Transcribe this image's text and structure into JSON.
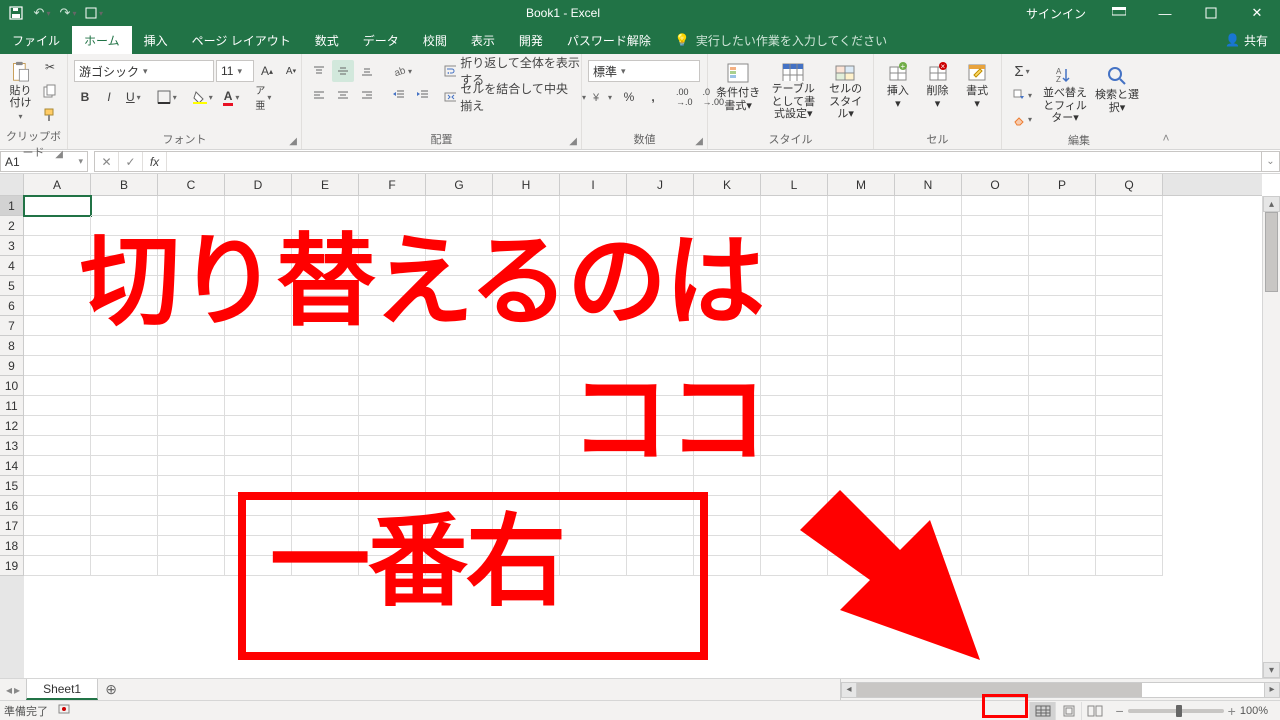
{
  "title": "Book1  -  Excel",
  "signin": "サインイン",
  "tabs": {
    "file": "ファイル",
    "home": "ホーム",
    "insert": "挿入",
    "pagelayout": "ページ レイアウト",
    "formulas": "数式",
    "data": "データ",
    "review": "校閲",
    "view": "表示",
    "developer": "開発",
    "password": "パスワード解除",
    "tellme": "実行したい作業を入力してください",
    "share": "共有"
  },
  "ribbon": {
    "clipboard": {
      "label": "クリップボード",
      "paste": "貼り付け"
    },
    "font": {
      "label": "フォント",
      "name": "游ゴシック",
      "size": "11"
    },
    "align": {
      "label": "配置",
      "wrap": "折り返して全体を表示する",
      "merge": "セルを結合して中央揃え"
    },
    "number": {
      "label": "数値",
      "format": "標準"
    },
    "styles": {
      "label": "スタイル",
      "cond": "条件付き書式",
      "table": "テーブルとして書式設定",
      "cell": "セルのスタイル"
    },
    "cells": {
      "label": "セル",
      "insert": "挿入",
      "delete": "削除",
      "format": "書式"
    },
    "editing": {
      "label": "編集",
      "sort": "並べ替えとフィルター",
      "find": "検索と選択"
    }
  },
  "namebox": "A1",
  "columns": [
    "A",
    "B",
    "C",
    "D",
    "E",
    "F",
    "G",
    "H",
    "I",
    "J",
    "K",
    "L",
    "M",
    "N",
    "O",
    "P",
    "Q"
  ],
  "rows": [
    "1",
    "2",
    "3",
    "4",
    "5",
    "6",
    "7",
    "8",
    "9",
    "10",
    "11",
    "12",
    "13",
    "14",
    "15",
    "16",
    "17",
    "18",
    "19"
  ],
  "sheet": "Sheet1",
  "status": {
    "ready": "準備完了",
    "zoom": "100%"
  },
  "annotation": {
    "l1": "切り替えるのは",
    "l2": "ココ",
    "l3": "一番右"
  }
}
